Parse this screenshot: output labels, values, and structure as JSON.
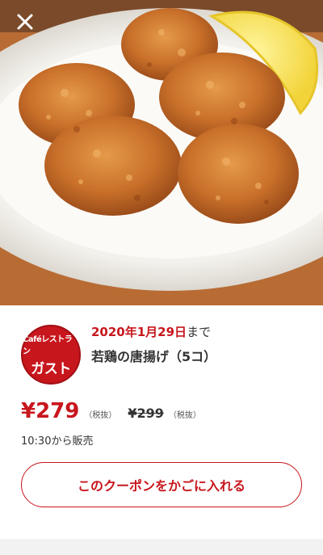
{
  "hero": {
    "image": "fried-chicken-karaage-photo"
  },
  "close": {
    "icon": "close-icon"
  },
  "brand": {
    "logo_sub": "Caféレストラン",
    "logo_main": "ガスト",
    "color": "#c8161d"
  },
  "coupon": {
    "expiry_date": "2020年1月29日",
    "expiry_suffix": "まで",
    "item_name": "若鶏の唐揚げ（5コ）",
    "price": "¥279",
    "price_tax": "（税抜）",
    "original_price": "¥299",
    "original_tax": "（税抜）",
    "sale_time": "10:30から販売",
    "add_button": "このクーポンをかごに入れる"
  }
}
